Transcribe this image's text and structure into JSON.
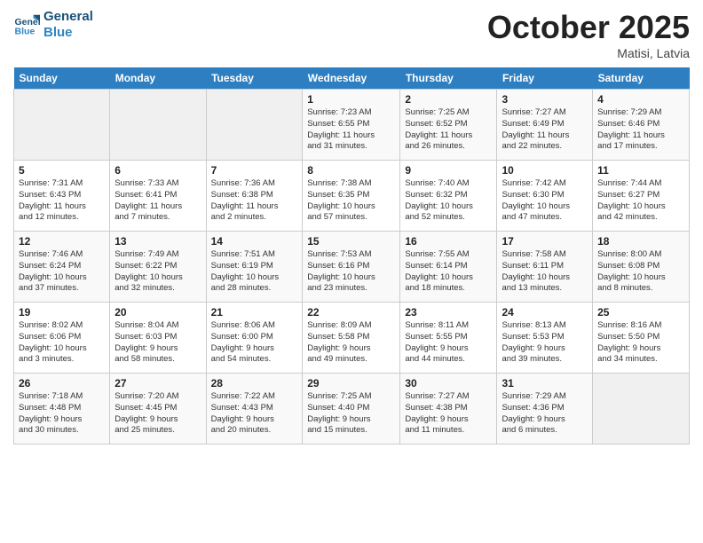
{
  "header": {
    "logo_line1": "General",
    "logo_line2": "Blue",
    "month_title": "October 2025",
    "subtitle": "Matisi, Latvia"
  },
  "weekdays": [
    "Sunday",
    "Monday",
    "Tuesday",
    "Wednesday",
    "Thursday",
    "Friday",
    "Saturday"
  ],
  "weeks": [
    [
      {
        "day": "",
        "info": ""
      },
      {
        "day": "",
        "info": ""
      },
      {
        "day": "",
        "info": ""
      },
      {
        "day": "1",
        "info": "Sunrise: 7:23 AM\nSunset: 6:55 PM\nDaylight: 11 hours\nand 31 minutes."
      },
      {
        "day": "2",
        "info": "Sunrise: 7:25 AM\nSunset: 6:52 PM\nDaylight: 11 hours\nand 26 minutes."
      },
      {
        "day": "3",
        "info": "Sunrise: 7:27 AM\nSunset: 6:49 PM\nDaylight: 11 hours\nand 22 minutes."
      },
      {
        "day": "4",
        "info": "Sunrise: 7:29 AM\nSunset: 6:46 PM\nDaylight: 11 hours\nand 17 minutes."
      }
    ],
    [
      {
        "day": "5",
        "info": "Sunrise: 7:31 AM\nSunset: 6:43 PM\nDaylight: 11 hours\nand 12 minutes."
      },
      {
        "day": "6",
        "info": "Sunrise: 7:33 AM\nSunset: 6:41 PM\nDaylight: 11 hours\nand 7 minutes."
      },
      {
        "day": "7",
        "info": "Sunrise: 7:36 AM\nSunset: 6:38 PM\nDaylight: 11 hours\nand 2 minutes."
      },
      {
        "day": "8",
        "info": "Sunrise: 7:38 AM\nSunset: 6:35 PM\nDaylight: 10 hours\nand 57 minutes."
      },
      {
        "day": "9",
        "info": "Sunrise: 7:40 AM\nSunset: 6:32 PM\nDaylight: 10 hours\nand 52 minutes."
      },
      {
        "day": "10",
        "info": "Sunrise: 7:42 AM\nSunset: 6:30 PM\nDaylight: 10 hours\nand 47 minutes."
      },
      {
        "day": "11",
        "info": "Sunrise: 7:44 AM\nSunset: 6:27 PM\nDaylight: 10 hours\nand 42 minutes."
      }
    ],
    [
      {
        "day": "12",
        "info": "Sunrise: 7:46 AM\nSunset: 6:24 PM\nDaylight: 10 hours\nand 37 minutes."
      },
      {
        "day": "13",
        "info": "Sunrise: 7:49 AM\nSunset: 6:22 PM\nDaylight: 10 hours\nand 32 minutes."
      },
      {
        "day": "14",
        "info": "Sunrise: 7:51 AM\nSunset: 6:19 PM\nDaylight: 10 hours\nand 28 minutes."
      },
      {
        "day": "15",
        "info": "Sunrise: 7:53 AM\nSunset: 6:16 PM\nDaylight: 10 hours\nand 23 minutes."
      },
      {
        "day": "16",
        "info": "Sunrise: 7:55 AM\nSunset: 6:14 PM\nDaylight: 10 hours\nand 18 minutes."
      },
      {
        "day": "17",
        "info": "Sunrise: 7:58 AM\nSunset: 6:11 PM\nDaylight: 10 hours\nand 13 minutes."
      },
      {
        "day": "18",
        "info": "Sunrise: 8:00 AM\nSunset: 6:08 PM\nDaylight: 10 hours\nand 8 minutes."
      }
    ],
    [
      {
        "day": "19",
        "info": "Sunrise: 8:02 AM\nSunset: 6:06 PM\nDaylight: 10 hours\nand 3 minutes."
      },
      {
        "day": "20",
        "info": "Sunrise: 8:04 AM\nSunset: 6:03 PM\nDaylight: 9 hours\nand 58 minutes."
      },
      {
        "day": "21",
        "info": "Sunrise: 8:06 AM\nSunset: 6:00 PM\nDaylight: 9 hours\nand 54 minutes."
      },
      {
        "day": "22",
        "info": "Sunrise: 8:09 AM\nSunset: 5:58 PM\nDaylight: 9 hours\nand 49 minutes."
      },
      {
        "day": "23",
        "info": "Sunrise: 8:11 AM\nSunset: 5:55 PM\nDaylight: 9 hours\nand 44 minutes."
      },
      {
        "day": "24",
        "info": "Sunrise: 8:13 AM\nSunset: 5:53 PM\nDaylight: 9 hours\nand 39 minutes."
      },
      {
        "day": "25",
        "info": "Sunrise: 8:16 AM\nSunset: 5:50 PM\nDaylight: 9 hours\nand 34 minutes."
      }
    ],
    [
      {
        "day": "26",
        "info": "Sunrise: 7:18 AM\nSunset: 4:48 PM\nDaylight: 9 hours\nand 30 minutes."
      },
      {
        "day": "27",
        "info": "Sunrise: 7:20 AM\nSunset: 4:45 PM\nDaylight: 9 hours\nand 25 minutes."
      },
      {
        "day": "28",
        "info": "Sunrise: 7:22 AM\nSunset: 4:43 PM\nDaylight: 9 hours\nand 20 minutes."
      },
      {
        "day": "29",
        "info": "Sunrise: 7:25 AM\nSunset: 4:40 PM\nDaylight: 9 hours\nand 15 minutes."
      },
      {
        "day": "30",
        "info": "Sunrise: 7:27 AM\nSunset: 4:38 PM\nDaylight: 9 hours\nand 11 minutes."
      },
      {
        "day": "31",
        "info": "Sunrise: 7:29 AM\nSunset: 4:36 PM\nDaylight: 9 hours\nand 6 minutes."
      },
      {
        "day": "",
        "info": ""
      }
    ]
  ]
}
